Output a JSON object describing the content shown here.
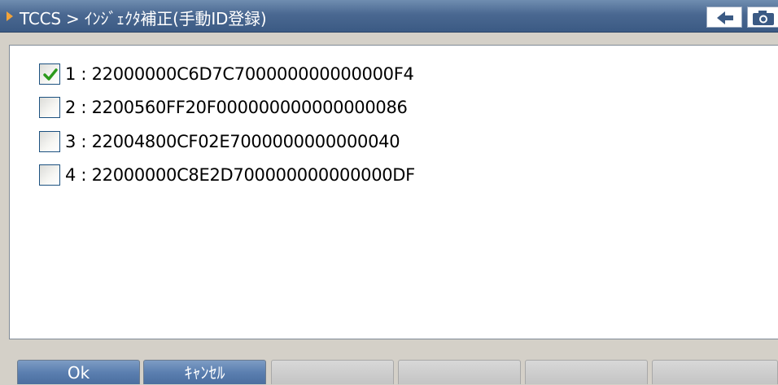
{
  "window": {
    "title": "TCCS > ｲﾝｼﾞｪｸﾀ補正(手動ID登録)"
  },
  "titlebar_buttons": [
    {
      "icon": "arrow-left-icon"
    },
    {
      "icon": "camera-icon"
    }
  ],
  "items": [
    {
      "label": "1 : 22000000C6D7C700000000000000F4",
      "checked": true
    },
    {
      "label": "2 : 2200560FF20F000000000000000086",
      "checked": false
    },
    {
      "label": "3 : 22004800CF02E7000000000000040",
      "checked": false
    },
    {
      "label": "4 : 22000000C8E2D700000000000000DF",
      "checked": false
    }
  ],
  "buttons": {
    "ok_label": "Ok",
    "cancel_label": "ｷｬﾝｾﾙ"
  },
  "colors": {
    "title_bar": "#4a6891",
    "accent_arrow": "#f2a33a",
    "check": "#2c9a1c",
    "active_button": "#5b7fb0"
  }
}
